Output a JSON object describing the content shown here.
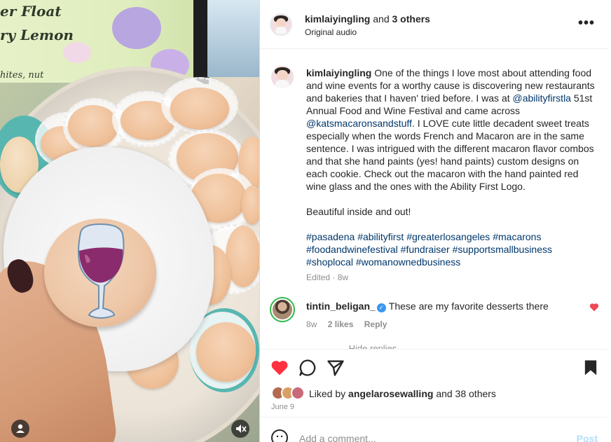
{
  "media": {
    "poster_line1": "er Float",
    "poster_line2": "ry Lemon",
    "poster_line3": "hites, nut"
  },
  "header": {
    "username": "kimlaiyingling",
    "and_text": "and",
    "others": "3 others",
    "audio": "Original audio",
    "more_label": "•••"
  },
  "caption": {
    "username": "kimlaiyingling",
    "part1": " One of the things I love most about attending food and wine events for a worthy cause is discovering new restaurants and bakeries that I haven' tried before. I was at ",
    "mention1": "@abilityfirstla",
    "part2": " 51st Annual Food and Wine Festival and came across ",
    "mention2": "@katsmacaronsandstuff",
    "part3": ". I LOVE cute little decadent sweet treats especially when the words French and Macaron are in the same sentence. I was intrigued with the different macaron flavor combos and that she hand paints (yes! hand paints) custom designs on each cookie. Check out the macaron with the hand painted red wine glass and the ones with the Ability First Logo.",
    "line2": "Beautiful inside and out!",
    "hashtags": [
      "#pasadena",
      "#abilityfirst",
      "#greaterlosangeles",
      "#macarons",
      "#foodandwinefestival",
      "#fundraiser",
      "#supportsmallbusiness",
      "#shoplocal",
      "#womanownedbusiness"
    ],
    "meta": "Edited · 8w"
  },
  "comment": {
    "username": "tintin_beligan_",
    "verified_mark": "✓",
    "text": "These are my favorite desserts there",
    "age": "8w",
    "likes": "2 likes",
    "reply": "Reply",
    "hidden_text": "— Hide replies"
  },
  "actions": {
    "liked_by_prefix": "Liked by",
    "liked_by_user": "angelarosewalling",
    "liked_by_suffix": "and 38 others",
    "date": "June 9",
    "comment_placeholder": "Add a comment...",
    "post_label": "Post"
  },
  "colors": {
    "like_red": "#ff3040",
    "link_blue": "#00376b",
    "verified_blue": "#3897f0",
    "post_disabled": "#b2dffc"
  },
  "icons": {
    "like": "heart-filled-icon",
    "comment": "comment-bubble-icon",
    "share": "paper-plane-icon",
    "save": "bookmark-filled-icon",
    "emoji": "smiley-icon",
    "mute": "speaker-muted-icon",
    "tag": "user-tag-icon"
  }
}
